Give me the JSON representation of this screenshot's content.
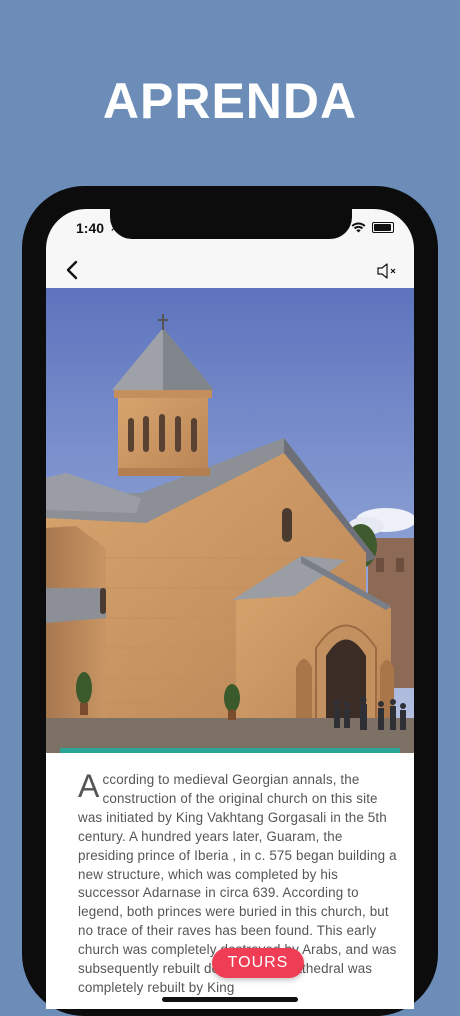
{
  "headline": "APRENDA",
  "status": {
    "time": "1:40"
  },
  "icons": {
    "back": "chevron-left-icon",
    "sound": "speaker-muted-icon",
    "location": "location-arrow-icon",
    "wifi": "wifi-icon",
    "battery": "battery-icon"
  },
  "progress": {
    "fraction": 1.0,
    "color": "#2aa596"
  },
  "article": {
    "drop_cap": "A",
    "text": "ccording to medieval Georgian annals, the construction of the original church on this site was initiated by King Vakhtang Gorgasali in the 5th century. A hundred years later, Guaram, the presiding prince of Iberia , in c. 575 began building a new structure, which was completed by his successor Adarnase in circa 639. According to legend, both princes were buried in this church, but no trace of their raves has been found. This early church was completely destroyed by Arabs, and was subsequently rebuilt de novo. The cathedral was completely rebuilt by King"
  },
  "tours_button": {
    "label": "TOURS",
    "color": "#ee3d54"
  },
  "colors": {
    "background": "#6b8db8"
  }
}
